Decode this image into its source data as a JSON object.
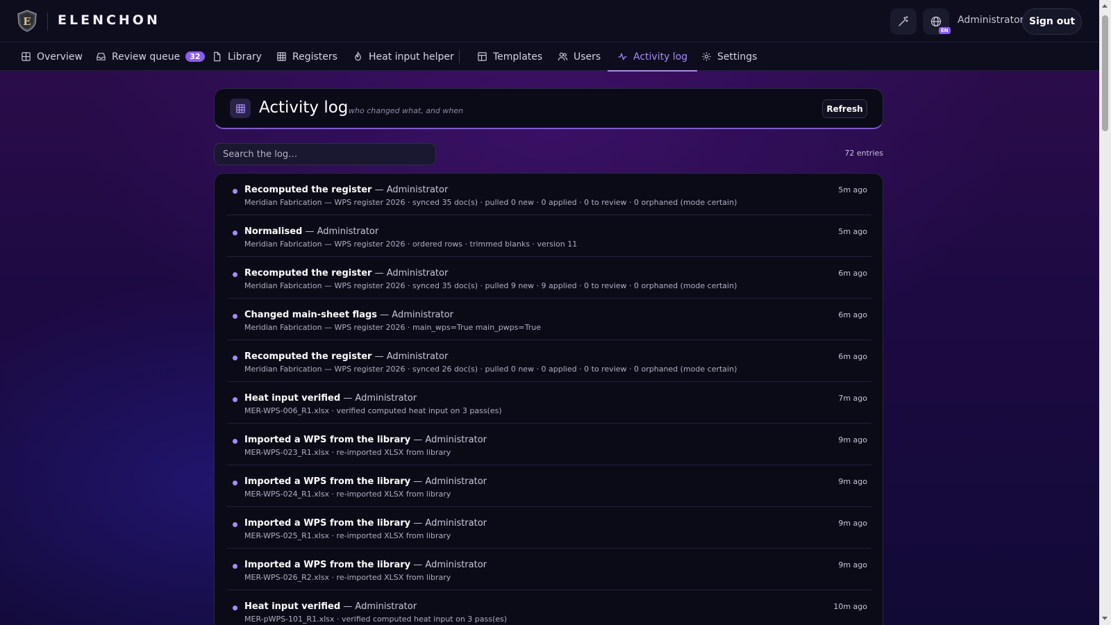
{
  "app": {
    "brand": "ELENCHON",
    "user": "Administrator",
    "sign_out": "Sign out",
    "lang": "EN"
  },
  "nav": [
    {
      "label": "Overview",
      "icon": "grid-icon"
    },
    {
      "label": "Review queue",
      "icon": "inbox-icon",
      "badge": "32"
    },
    {
      "label": "Library",
      "icon": "file-icon"
    },
    {
      "label": "Registers",
      "icon": "table-icon"
    },
    {
      "label": "Heat input helper",
      "icon": "flame-icon"
    },
    {
      "label": "Templates",
      "icon": "template-icon"
    },
    {
      "label": "Users",
      "icon": "users-icon"
    },
    {
      "label": "Activity log",
      "icon": "activity-icon",
      "active": true
    },
    {
      "label": "Settings",
      "icon": "gear-icon"
    }
  ],
  "header": {
    "title": "Activity log",
    "subtitle": "who changed what, and when",
    "refresh": "Refresh"
  },
  "search": {
    "placeholder": "Search the log…"
  },
  "entries_count": "72 entries",
  "accent": "#a78bfa",
  "log": [
    {
      "action": "Recomputed the register",
      "actor": "— Administrator",
      "detail": "Meridian Fabrication — WPS register 2026 · synced 35 doc(s) · pulled 0 new · 0 applied · 0 to review · 0 orphaned (mode certain)",
      "time": "5m ago"
    },
    {
      "action": "Normalised",
      "actor": "— Administrator",
      "detail": "Meridian Fabrication — WPS register 2026 · ordered rows · trimmed blanks · version 11",
      "time": "5m ago"
    },
    {
      "action": "Recomputed the register",
      "actor": "— Administrator",
      "detail": "Meridian Fabrication — WPS register 2026 · synced 35 doc(s) · pulled 9 new · 9 applied · 0 to review · 0 orphaned (mode certain)",
      "time": "6m ago"
    },
    {
      "action": "Changed main-sheet flags",
      "actor": "— Administrator",
      "detail": "Meridian Fabrication — WPS register 2026 · main_wps=True main_pwps=True",
      "time": "6m ago"
    },
    {
      "action": "Recomputed the register",
      "actor": "— Administrator",
      "detail": "Meridian Fabrication — WPS register 2026 · synced 26 doc(s) · pulled 0 new · 0 applied · 0 to review · 0 orphaned (mode certain)",
      "time": "6m ago"
    },
    {
      "action": "Heat input verified",
      "actor": "— Administrator",
      "detail": "MER-WPS-006_R1.xlsx · verified computed heat input on 3 pass(es)",
      "time": "7m ago"
    },
    {
      "action": "Imported a WPS from the library",
      "actor": "— Administrator",
      "detail": "MER-WPS-023_R1.xlsx · re-imported XLSX from library",
      "time": "9m ago"
    },
    {
      "action": "Imported a WPS from the library",
      "actor": "— Administrator",
      "detail": "MER-WPS-024_R1.xlsx · re-imported XLSX from library",
      "time": "9m ago"
    },
    {
      "action": "Imported a WPS from the library",
      "actor": "— Administrator",
      "detail": "MER-WPS-025_R1.xlsx · re-imported XLSX from library",
      "time": "9m ago"
    },
    {
      "action": "Imported a WPS from the library",
      "actor": "— Administrator",
      "detail": "MER-WPS-026_R2.xlsx · re-imported XLSX from library",
      "time": "9m ago"
    },
    {
      "action": "Heat input verified",
      "actor": "— Administrator",
      "detail": "MER-pWPS-101_R1.xlsx · verified computed heat input on 3 pass(es)",
      "time": "10m ago"
    }
  ]
}
